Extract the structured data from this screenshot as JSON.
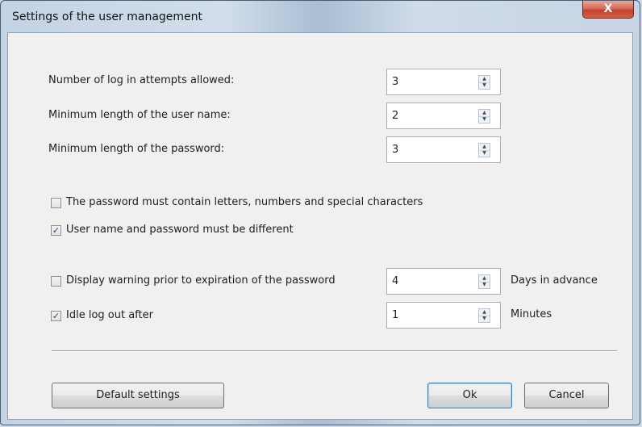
{
  "window": {
    "title": "Settings of the user management",
    "close_glyph": "X"
  },
  "fields": [
    {
      "label": "Number of log in attempts allowed:",
      "value": "3"
    },
    {
      "label": "Minimum length of the user name:",
      "value": "2"
    },
    {
      "label": "Minimum length of the password:",
      "value": "3"
    }
  ],
  "checkboxes": [
    {
      "label": "The password must contain letters, numbers and special characters",
      "checked": false
    },
    {
      "label": "User name and password must be different",
      "checked": true
    }
  ],
  "options": [
    {
      "label": "Display warning prior to expiration of the password",
      "checked": false,
      "value": "4",
      "unit": "Days in advance"
    },
    {
      "label": "Idle log out after",
      "checked": true,
      "value": "1",
      "unit": "Minutes"
    }
  ],
  "buttons": {
    "default_settings": "Default settings",
    "ok": "Ok",
    "cancel": "Cancel"
  },
  "icons": {
    "check": "✓",
    "spin_up": "▲",
    "spin_down": "▼"
  }
}
